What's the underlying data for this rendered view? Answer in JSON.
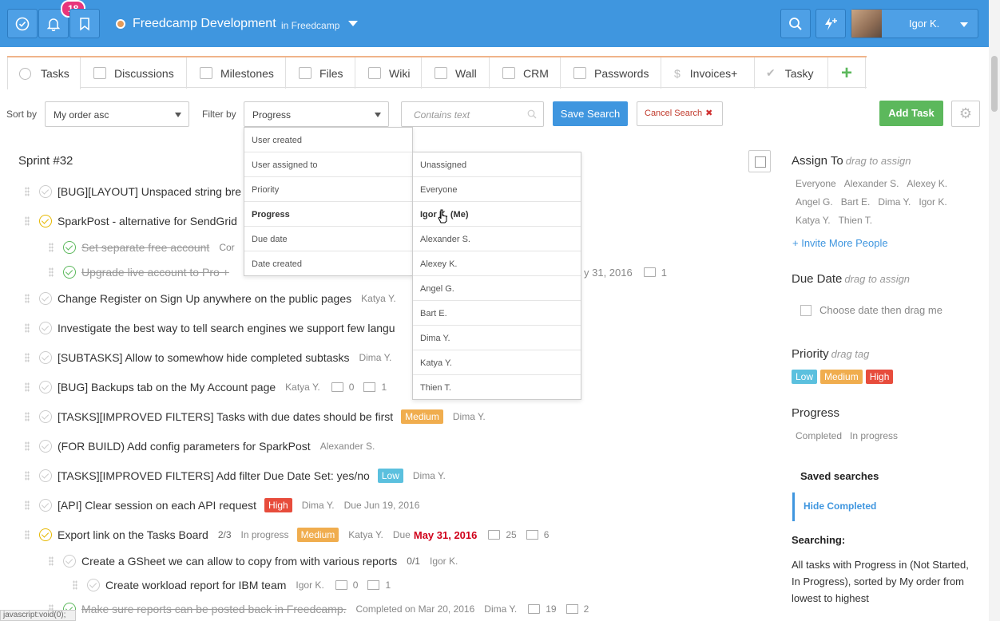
{
  "topbar": {
    "notifications_count": "18",
    "project_name": "Freedcamp Development",
    "project_context": "in Freedcamp",
    "user_name": "Igor K."
  },
  "tabs": [
    {
      "label": "Tasks",
      "icon": "check-circle-icon"
    },
    {
      "label": "Discussions",
      "icon": "comment-icon"
    },
    {
      "label": "Milestones",
      "icon": "checkbox-icon"
    },
    {
      "label": "Files",
      "icon": "folder-icon"
    },
    {
      "label": "Wiki",
      "icon": "book-icon"
    },
    {
      "label": "Wall",
      "icon": "document-icon"
    },
    {
      "label": "CRM",
      "icon": "card-icon"
    },
    {
      "label": "Passwords",
      "icon": "lock-icon"
    },
    {
      "label": "Invoices+",
      "icon": "dollar-icon"
    },
    {
      "label": "Tasky",
      "icon": "check-icon"
    }
  ],
  "toolbar": {
    "sort_label": "Sort by",
    "sort_value": "My order asc",
    "filter_label": "Filter by",
    "filter_value": "Progress",
    "search_placeholder": "Contains text",
    "save_search": "Save Search",
    "cancel_search": "Cancel Search",
    "add_task": "Add Task"
  },
  "filter_menu": [
    "User created",
    "User assigned to",
    "Priority",
    "Progress",
    "Due date",
    "Date created"
  ],
  "user_menu": [
    "Unassigned",
    "Everyone",
    "Igor K. (Me)",
    "Alexander S.",
    "Alexey K.",
    "Angel G.",
    "Bart E.",
    "Dima Y.",
    "Katya Y.",
    "Thien T."
  ],
  "sprint": "Sprint #32",
  "tasks": [
    {
      "title": "[BUG][LAYOUT] Unspaced string bre"
    },
    {
      "title": "SparkPost - alternative for SendGrid"
    },
    {
      "title": "Set separate free account",
      "meta": "Cor"
    },
    {
      "title": "Upgrade live account to Pro +",
      "date": "y 31, 2016",
      "comments": "1"
    },
    {
      "title": "Change Register on Sign Up anywhere on the public pages",
      "assignee": "Katya Y."
    },
    {
      "title": "Investigate the best way to tell search engines we support few langu"
    },
    {
      "title": "[SUBTASKS] Allow to somewhow hide completed subtasks",
      "assignee": "Dima Y."
    },
    {
      "title": "[BUG] Backups tab on the My Account page",
      "assignee": "Katya Y.",
      "comments": "0",
      "files": "1"
    },
    {
      "title": "[TASKS][IMPROVED FILTERS] Tasks with due dates should be first",
      "tag": "Medium",
      "assignee": "Dima Y."
    },
    {
      "title": "(FOR BUILD) Add config parameters for SparkPost",
      "assignee": "Alexander S."
    },
    {
      "title": "[TASKS][IMPROVED FILTERS] Add filter Due Date Set: yes/no",
      "tag": "Low",
      "assignee": "Dima Y."
    },
    {
      "title": "[API] Clear session on each API request",
      "tag": "High",
      "assignee": "Dima Y.",
      "due": "Due Jun 19, 2016"
    },
    {
      "title": "Export link on the Tasks Board",
      "progress": "2/3",
      "status": "In progress",
      "tag": "Medium",
      "assignee": "Katya Y.",
      "due_label": "Due",
      "due_date": "May 31, 2016",
      "comments": "25",
      "files": "6"
    },
    {
      "title": "Create a GSheet we can allow to copy from with various reports",
      "progress": "0/1",
      "assignee": "Igor K."
    },
    {
      "title": "Create workload report for IBM team",
      "assignee": "Igor K.",
      "comments": "0",
      "files": "1"
    },
    {
      "title": "Make sure reports can be posted back in Freedcamp.",
      "completed": "Completed on Mar 20, 2016",
      "assignee": "Dima Y.",
      "comments": "19",
      "files": "2"
    }
  ],
  "sidebar": {
    "assign_title": "Assign To",
    "assign_hint": "drag to assign",
    "people": [
      "Everyone",
      "Alexander S.",
      "Alexey K.",
      "Angel G.",
      "Bart E.",
      "Dima Y.",
      "Igor K.",
      "Katya Y.",
      "Thien T."
    ],
    "invite": "+ Invite More People",
    "due_title": "Due Date",
    "due_hint": "drag to assign",
    "due_choose": "Choose date then drag me",
    "priority_title": "Priority",
    "priority_hint": "drag tag",
    "priority_tags": [
      "Low",
      "Medium",
      "High"
    ],
    "progress_title": "Progress",
    "progress_items": [
      "Completed",
      "In progress"
    ],
    "saved_title": "Saved searches",
    "saved_item": "Hide Completed",
    "searching_title": "Searching:",
    "searching_text": "All tasks with Progress in (Not Started, In Progress), sorted by My order from lowest to highest"
  },
  "status_url": "javascript:void(0);",
  "colors": {
    "primary": "#3f96df",
    "accent_badge": "#e9357b",
    "add_green": "#5cb85c",
    "medium": "#f0ad4e",
    "low": "#5bc0de",
    "high": "#e74c3c"
  }
}
